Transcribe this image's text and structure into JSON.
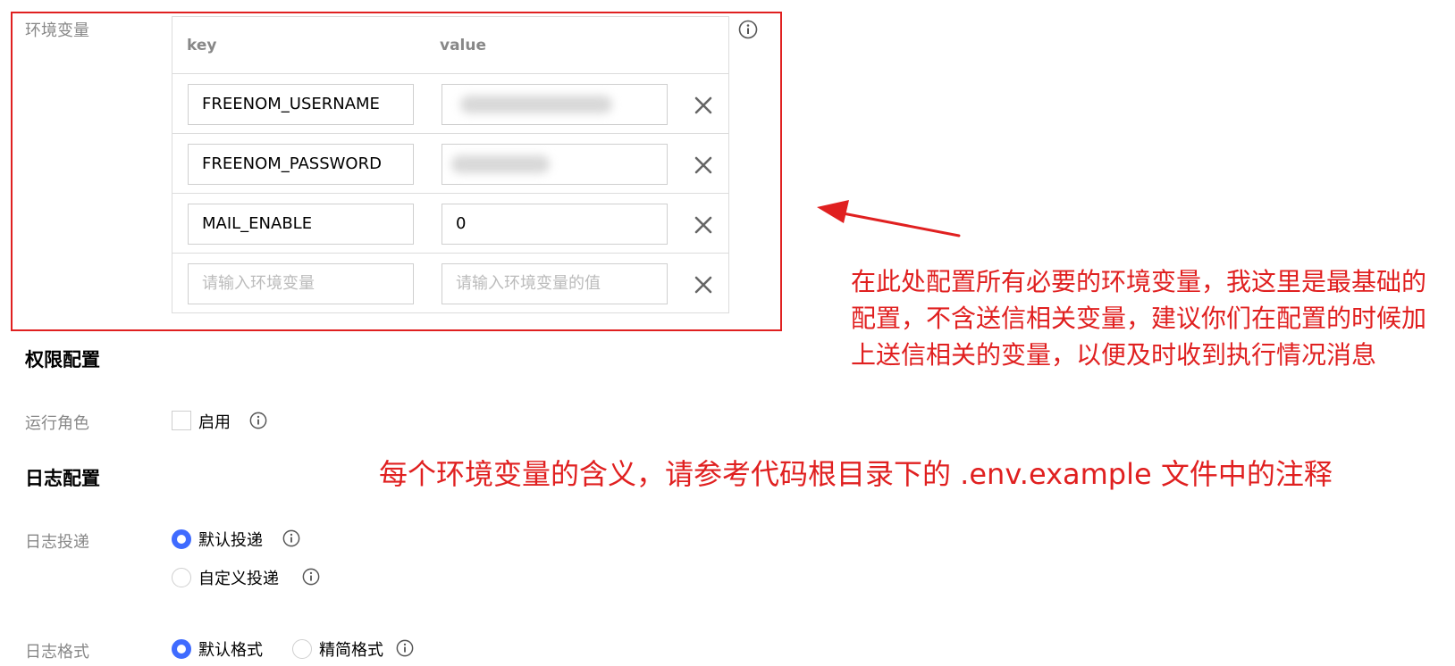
{
  "env": {
    "label": "环境变量",
    "columns": {
      "key": "key",
      "value": "value"
    },
    "rows": [
      {
        "key": "FREENOM_USERNAME",
        "value": ""
      },
      {
        "key": "FREENOM_PASSWORD",
        "value": ""
      },
      {
        "key": "MAIL_ENABLE",
        "value": "0"
      }
    ],
    "new_row": {
      "key_placeholder": "请输入环境变量",
      "value_placeholder": "请输入环境变量的值"
    }
  },
  "permission": {
    "title": "权限配置",
    "role_label": "运行角色",
    "enable_label": "启用",
    "enable_checked": false
  },
  "log": {
    "title": "日志配置",
    "delivery_label": "日志投递",
    "delivery_options": [
      "默认投递",
      "自定义投递"
    ],
    "delivery_selected": "默认投递",
    "format_label": "日志格式",
    "format_options": [
      "默认格式",
      "精简格式"
    ],
    "format_selected": "默认格式"
  },
  "annotations": {
    "block": "在此处配置所有必要的环境变量，我这里是最基础的配置，不含送信相关变量，建议你们在配置的时候加上送信相关的变量，以便及时收到执行情况消息",
    "line": "每个环境变量的含义，请参考代码根目录下的 .env.example 文件中的注释"
  },
  "colors": {
    "annotation_red": "#e02020",
    "radio_blue": "#3f6bff",
    "label_gray": "#888888"
  },
  "icons": {
    "delete": "close-icon",
    "info": "info-icon",
    "arrow": "arrow-icon"
  }
}
